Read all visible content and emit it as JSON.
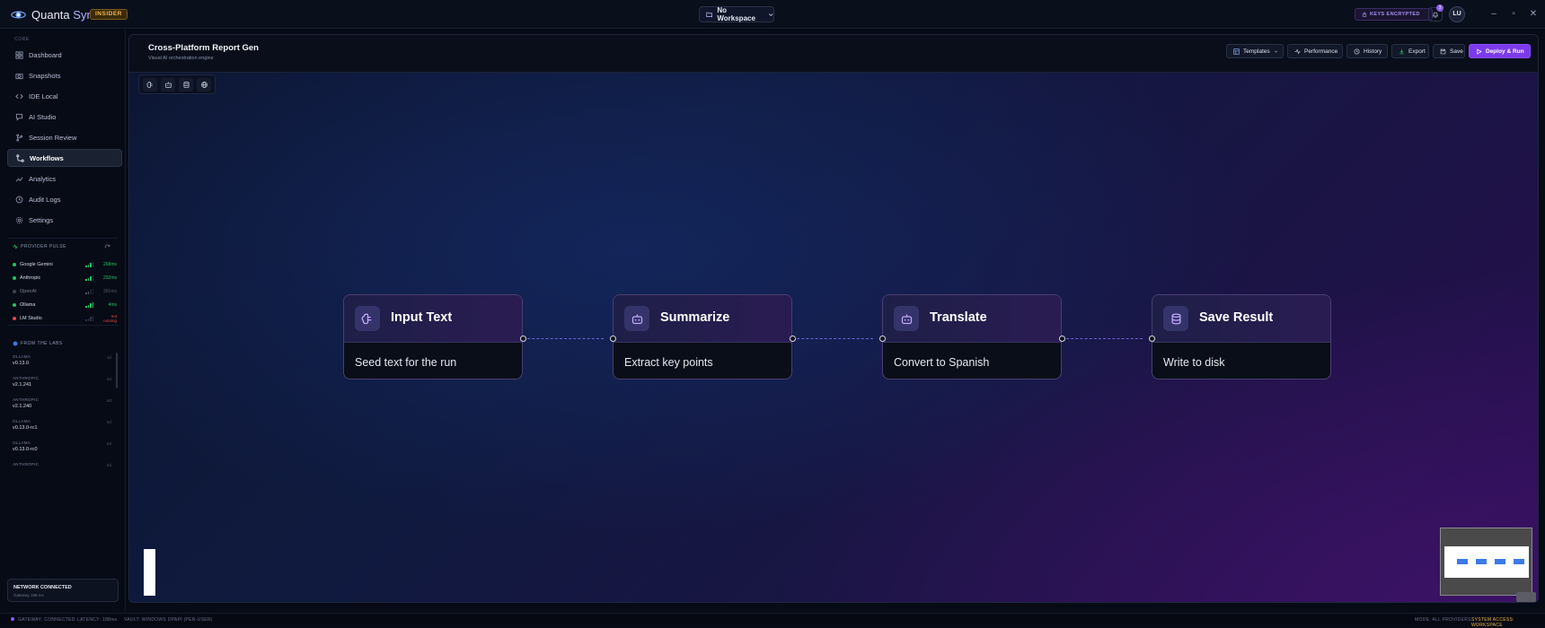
{
  "colors": {
    "accent": "#7c3aed",
    "brand": "#b8b4ff",
    "online": "#22c55e",
    "offline": "#ef4444",
    "canvas_bg": "#0f1a3e"
  },
  "app": {
    "name_prefix": "Quanta",
    "name_suffix": "Sync",
    "badge": "INSIDER"
  },
  "workspace": {
    "label": "No Workspace",
    "icon": "folder-icon"
  },
  "header": {
    "keys_badge": "KEYS ENCRYPTED",
    "notifications": "3",
    "avatar": "LU"
  },
  "sidebar": {
    "section": "CORE",
    "items": [
      {
        "label": "Dashboard",
        "icon": "grid-icon"
      },
      {
        "label": "Snapshots",
        "icon": "camera-icon"
      },
      {
        "label": "IDE Local",
        "icon": "code-icon"
      },
      {
        "label": "AI Studio",
        "icon": "chat-icon"
      },
      {
        "label": "Session Review",
        "icon": "branch-icon"
      },
      {
        "label": "Workflows",
        "icon": "workflow-icon"
      },
      {
        "label": "Analytics",
        "icon": "chart-icon"
      },
      {
        "label": "Audit Logs",
        "icon": "clock-icon"
      },
      {
        "label": "Settings",
        "icon": "gear-icon"
      }
    ],
    "active_index": 5
  },
  "provider_pulse": {
    "title": "PROVIDER PULSE",
    "providers": [
      {
        "name": "Google Gemini",
        "status": "online",
        "latency": "268ms",
        "bars": 3
      },
      {
        "name": "Anthropic",
        "status": "online",
        "latency": "232ms",
        "bars": 3
      },
      {
        "name": "OpenAI",
        "status": "idle",
        "latency": "391ms",
        "bars": 2
      },
      {
        "name": "Ollama",
        "status": "online",
        "latency": "4ms",
        "bars": 4
      },
      {
        "name": "LM Studio",
        "status": "offline",
        "latency": "not running",
        "bars": 0
      }
    ]
  },
  "labs": {
    "title": "FROM THE LABS",
    "releases": [
      {
        "vendor": "OLLAMA",
        "version": "v0.13.0",
        "age": "4d"
      },
      {
        "vendor": "ANTHROPIC",
        "version": "v2.1.241",
        "age": "6d"
      },
      {
        "vendor": "ANTHROPIC",
        "version": "v2.1.240",
        "age": "6d"
      },
      {
        "vendor": "OLLAMA",
        "version": "v0.13.0-rc1",
        "age": "6d"
      },
      {
        "vendor": "OLLAMA",
        "version": "v0.13.0-rc0",
        "age": "6d"
      },
      {
        "vendor": "ANTHROPIC",
        "version": "",
        "age": "6d"
      }
    ]
  },
  "network": {
    "title": "NETWORK CONNECTED",
    "subtitle": "Gateway 198 ms"
  },
  "workflow": {
    "title": "Cross-Platform Report Gen",
    "subtitle": "Visual AI orchestration engine"
  },
  "toolbar": {
    "templates": "Templates",
    "performance": "Performance",
    "history": "History",
    "export": "Export",
    "save": "Save",
    "deploy": "Deploy & Run"
  },
  "tools": [
    "ai-brain-icon",
    "bot-icon",
    "database-icon",
    "globe-icon"
  ],
  "nodes": [
    {
      "title": "Input Text",
      "description": "Seed text for the run",
      "icon": "ai-brain-icon"
    },
    {
      "title": "Summarize",
      "description": "Extract key points",
      "icon": "bot-icon"
    },
    {
      "title": "Translate",
      "description": "Convert to Spanish",
      "icon": "bot-icon"
    },
    {
      "title": "Save Result",
      "description": "Write to disk",
      "icon": "database-icon"
    }
  ],
  "statusbar": {
    "gateway": "GATEWAY: CONNECTED",
    "latency": "LATENCY: 188ms",
    "vault": "VAULT: WINDOWS DPAPI (PER-USER)",
    "mode": "MODE: ALL PROVIDERS",
    "access": "SYSTEM ACCESS: WORKSPACE"
  }
}
